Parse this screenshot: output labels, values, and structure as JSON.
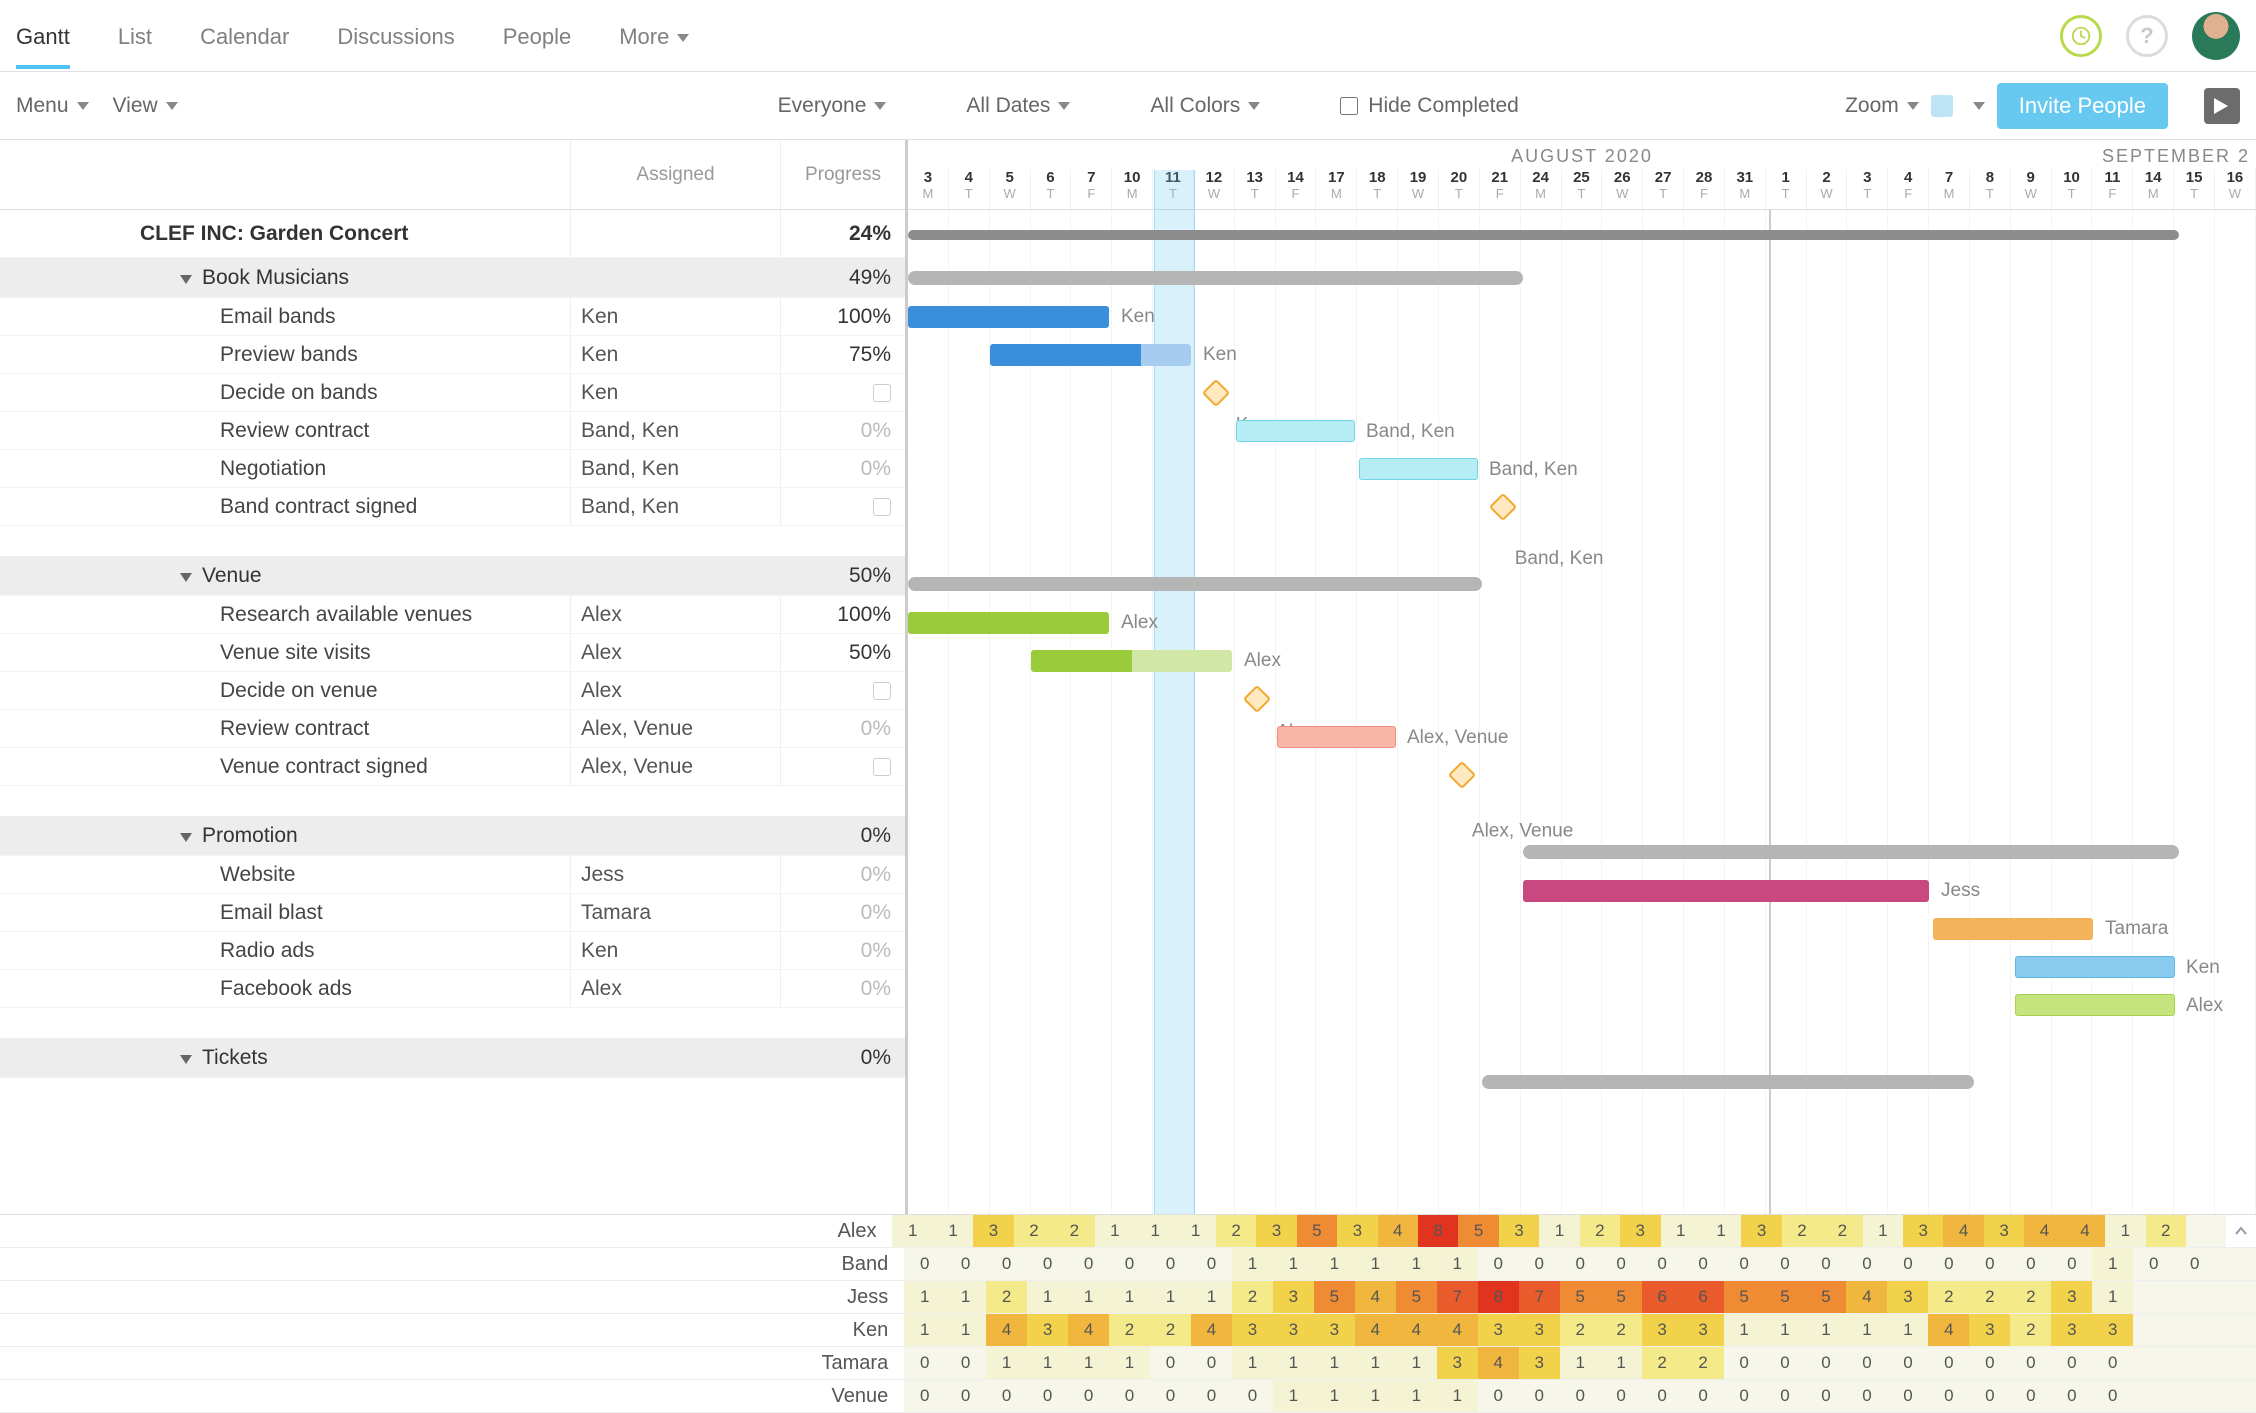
{
  "nav": {
    "tabs": [
      "Gantt",
      "List",
      "Calendar",
      "Discussions",
      "People",
      "More"
    ],
    "active": 0
  },
  "filters": {
    "menu": "Menu",
    "view": "View",
    "people": "Everyone",
    "dates": "All Dates",
    "colors": "All Colors",
    "hide_completed": "Hide Completed",
    "zoom": "Zoom",
    "invite": "Invite People"
  },
  "columns": {
    "assigned": "Assigned",
    "progress": "Progress"
  },
  "months": {
    "main": "AUGUST 2020",
    "next": "SEPTEMBER 2"
  },
  "days": [
    {
      "n": "3",
      "d": "M"
    },
    {
      "n": "4",
      "d": "T"
    },
    {
      "n": "5",
      "d": "W"
    },
    {
      "n": "6",
      "d": "T"
    },
    {
      "n": "7",
      "d": "F"
    },
    {
      "n": "10",
      "d": "M"
    },
    {
      "n": "11",
      "d": "T"
    },
    {
      "n": "12",
      "d": "W"
    },
    {
      "n": "13",
      "d": "T"
    },
    {
      "n": "14",
      "d": "F"
    },
    {
      "n": "17",
      "d": "M"
    },
    {
      "n": "18",
      "d": "T"
    },
    {
      "n": "19",
      "d": "W"
    },
    {
      "n": "20",
      "d": "T"
    },
    {
      "n": "21",
      "d": "F"
    },
    {
      "n": "24",
      "d": "M"
    },
    {
      "n": "25",
      "d": "T"
    },
    {
      "n": "26",
      "d": "W"
    },
    {
      "n": "27",
      "d": "T"
    },
    {
      "n": "28",
      "d": "F"
    },
    {
      "n": "31",
      "d": "M"
    },
    {
      "n": "1",
      "d": "T"
    },
    {
      "n": "2",
      "d": "W"
    },
    {
      "n": "3",
      "d": "T"
    },
    {
      "n": "4",
      "d": "F"
    },
    {
      "n": "7",
      "d": "M"
    },
    {
      "n": "8",
      "d": "T"
    },
    {
      "n": "9",
      "d": "W"
    },
    {
      "n": "10",
      "d": "T"
    },
    {
      "n": "11",
      "d": "F"
    },
    {
      "n": "14",
      "d": "M"
    },
    {
      "n": "15",
      "d": "T"
    },
    {
      "n": "16",
      "d": "W"
    }
  ],
  "today_index": 6,
  "month_divider_index": 21,
  "project": {
    "name": "CLEF INC: Garden Concert",
    "progress": "24%"
  },
  "groups": [
    {
      "name": "Book Musicians",
      "progress": "49%",
      "summary": {
        "start": 0,
        "span": 15
      },
      "tasks": [
        {
          "name": "Email bands",
          "assigned": "Ken",
          "progress": "100%",
          "bar": {
            "start": 0,
            "span": 5,
            "color": "c-blue",
            "label": "Ken"
          }
        },
        {
          "name": "Preview bands",
          "assigned": "Ken",
          "progress": "75%",
          "bar": {
            "start": 2,
            "span": 5,
            "color": "c-blue2",
            "label": "Ken",
            "partial": 25
          }
        },
        {
          "name": "Decide on bands",
          "assigned": "Ken",
          "progress": "",
          "milestone": {
            "at": 7.5,
            "label": "Ken"
          }
        },
        {
          "name": "Review contract",
          "assigned": "Band, Ken",
          "progress": "0%",
          "bar": {
            "start": 8,
            "span": 3,
            "color": "c-cyan",
            "label": "Band, Ken"
          }
        },
        {
          "name": "Negotiation",
          "assigned": "Band, Ken",
          "progress": "0%",
          "bar": {
            "start": 11,
            "span": 3,
            "color": "c-cyan",
            "label": "Band, Ken"
          }
        },
        {
          "name": "Band contract signed",
          "assigned": "Band, Ken",
          "progress": "",
          "milestone": {
            "at": 14.5,
            "label": "Band, Ken"
          }
        }
      ]
    },
    {
      "name": "Venue",
      "progress": "50%",
      "summary": {
        "start": 0,
        "span": 14
      },
      "tasks": [
        {
          "name": "Research available venues",
          "assigned": "Alex",
          "progress": "100%",
          "bar": {
            "start": 0,
            "span": 5,
            "color": "c-green",
            "label": "Alex"
          }
        },
        {
          "name": "Venue site visits",
          "assigned": "Alex",
          "progress": "50%",
          "bar": {
            "start": 3,
            "span": 5,
            "color": "c-green",
            "label": "Alex",
            "partial": 50
          }
        },
        {
          "name": "Decide on venue",
          "assigned": "Alex",
          "progress": "",
          "milestone": {
            "at": 8.5,
            "label": "Alex"
          }
        },
        {
          "name": "Review contract",
          "assigned": "Alex, Venue",
          "progress": "0%",
          "bar": {
            "start": 9,
            "span": 3,
            "color": "c-red",
            "label": "Alex, Venue"
          }
        },
        {
          "name": "Venue contract signed",
          "assigned": "Alex, Venue",
          "progress": "",
          "milestone": {
            "at": 13.5,
            "label": "Alex, Venue"
          }
        }
      ]
    },
    {
      "name": "Promotion",
      "progress": "0%",
      "summary": {
        "start": 15,
        "span": 16
      },
      "tasks": [
        {
          "name": "Website",
          "assigned": "Jess",
          "progress": "0%",
          "bar": {
            "start": 15,
            "span": 10,
            "color": "c-pink",
            "label": "Jess"
          }
        },
        {
          "name": "Email blast",
          "assigned": "Tamara",
          "progress": "0%",
          "bar": {
            "start": 25,
            "span": 4,
            "color": "c-orange",
            "label": "Tamara"
          }
        },
        {
          "name": "Radio ads",
          "assigned": "Ken",
          "progress": "0%",
          "bar": {
            "start": 27,
            "span": 4,
            "color": "c-sky",
            "label": "Ken"
          }
        },
        {
          "name": "Facebook ads",
          "assigned": "Alex",
          "progress": "0%",
          "bar": {
            "start": 27,
            "span": 4,
            "color": "c-lime",
            "label": "Alex"
          }
        }
      ]
    },
    {
      "name": "Tickets",
      "progress": "0%",
      "summary": {
        "start": 14,
        "span": 12
      },
      "tasks": []
    }
  ],
  "heatmap": {
    "people": [
      "Alex",
      "Band",
      "Jess",
      "Ken",
      "Tamara",
      "Venue"
    ],
    "rows": [
      [
        1,
        1,
        3,
        2,
        2,
        1,
        1,
        1,
        2,
        3,
        5,
        3,
        4,
        8,
        5,
        3,
        1,
        2,
        3,
        1,
        1,
        3,
        2,
        2,
        1,
        3,
        4,
        3,
        4,
        4,
        1,
        2,
        null
      ],
      [
        0,
        0,
        0,
        0,
        0,
        0,
        0,
        0,
        1,
        1,
        1,
        1,
        1,
        1,
        0,
        0,
        0,
        0,
        0,
        0,
        0,
        0,
        0,
        0,
        0,
        0,
        0,
        0,
        0,
        1,
        0,
        0,
        null
      ],
      [
        1,
        1,
        2,
        1,
        1,
        1,
        1,
        1,
        2,
        3,
        5,
        4,
        5,
        7,
        8,
        7,
        5,
        5,
        6,
        6,
        5,
        5,
        5,
        4,
        3,
        2,
        2,
        2,
        3,
        1,
        null,
        null,
        null
      ],
      [
        1,
        1,
        4,
        3,
        4,
        2,
        2,
        4,
        3,
        3,
        3,
        4,
        4,
        4,
        3,
        3,
        2,
        2,
        3,
        3,
        1,
        1,
        1,
        1,
        1,
        4,
        3,
        2,
        3,
        3,
        null,
        null,
        null
      ],
      [
        0,
        0,
        1,
        1,
        1,
        1,
        0,
        0,
        1,
        1,
        1,
        1,
        1,
        3,
        4,
        3,
        1,
        1,
        2,
        2,
        0,
        0,
        0,
        0,
        0,
        0,
        0,
        0,
        0,
        0,
        null,
        null,
        null
      ],
      [
        0,
        0,
        0,
        0,
        0,
        0,
        0,
        0,
        0,
        1,
        1,
        1,
        1,
        1,
        0,
        0,
        0,
        0,
        0,
        0,
        0,
        0,
        0,
        0,
        0,
        0,
        0,
        0,
        0,
        0,
        null,
        null,
        null
      ]
    ]
  }
}
